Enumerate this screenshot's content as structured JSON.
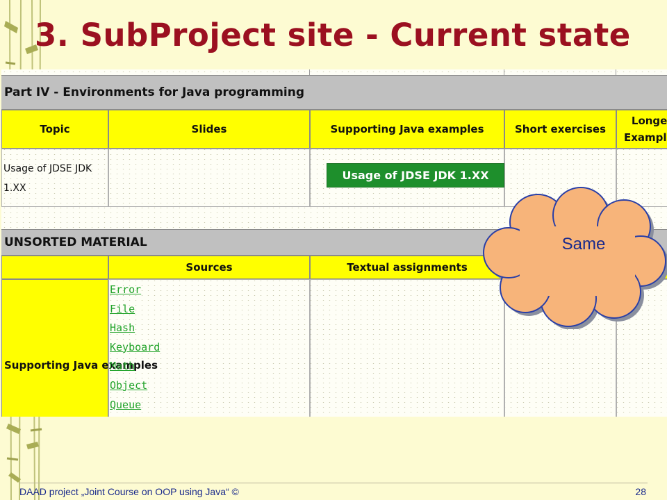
{
  "slide": {
    "title": "3. SubProject site - Current state"
  },
  "part4": {
    "header": "Part IV - Environments for Java programming",
    "columns": [
      "Topic",
      "Slides",
      "Supporting Java examples",
      "Short exercises",
      "Longer Examples"
    ],
    "row": {
      "topic": "Usage of JDSE JDK 1.XX",
      "example_badge": "Usage of JDSE JDK 1.XX"
    }
  },
  "unsorted": {
    "header": "UNSORTED MATERIAL",
    "columns": [
      "Sources",
      "Textual assignments"
    ],
    "row_label": "Supporting Java examples",
    "links": [
      "Error",
      "File",
      "Hash",
      "Keyboard",
      "Math",
      "Object",
      "Queue"
    ]
  },
  "callout": {
    "text": "Same"
  },
  "footer": {
    "left": "DAAD project „Joint Course on OOP using Java“ ©",
    "page": "28"
  },
  "colors": {
    "title": "#9b1020",
    "section_header": "#c0c0c0",
    "column_header": "#ffff00",
    "badge": "#1e8f2c",
    "link": "#22a32a",
    "cloud_fill": "#f7b47a",
    "footer_text": "#1a2a8c"
  }
}
